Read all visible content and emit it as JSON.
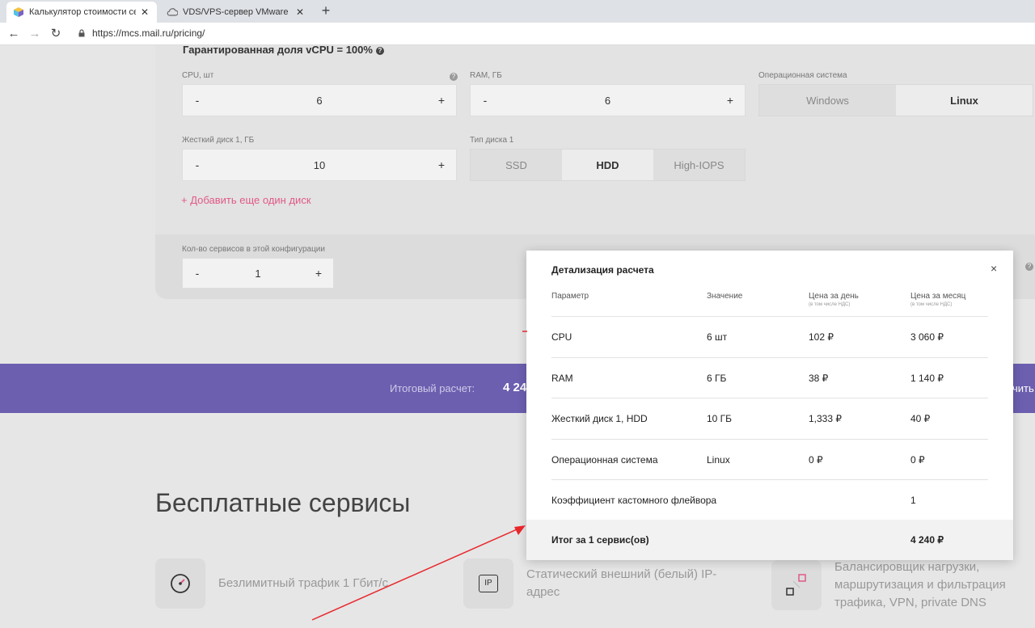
{
  "browser": {
    "tabs": [
      {
        "title": "Калькулятор стоимости серв",
        "active": true
      },
      {
        "title": "VDS/VPS-сервер VMware в",
        "active": false
      }
    ],
    "url": "https://mcs.mail.ru/pricing/"
  },
  "config": {
    "vcpu_title": "Гарантированная доля vCPU = 100%",
    "cpu": {
      "label": "CPU, шт",
      "value": "6"
    },
    "ram": {
      "label": "RAM, ГБ",
      "value": "6"
    },
    "os": {
      "label": "Операционная система",
      "options": [
        "Windows",
        "Linux"
      ],
      "selected": "Linux"
    },
    "disk": {
      "label": "Жесткий диск 1, ГБ",
      "value": "10"
    },
    "disk_type": {
      "label": "Тип диска 1",
      "options": [
        "SSD",
        "HDD",
        "High-IOPS"
      ],
      "selected": "HDD"
    },
    "add_disk": "+ Добавить еще один диск",
    "services_count": {
      "label": "Кол-во сервисов в этой конфигурации",
      "value": "1"
    },
    "minus": "-",
    "plus": "+",
    "q": "?"
  },
  "total_bar": {
    "label": "Итоговый расчет:",
    "value": "4 24",
    "order_fragment": "чить"
  },
  "free_services": {
    "title": "Бесплатные сервисы",
    "items": [
      {
        "text": "Безлимитный трафик 1 Гбит/с",
        "icon": "speedometer-icon"
      },
      {
        "text": "Статический внешний (белый) IP-адрес",
        "icon": "ip-icon",
        "icon_text": "IP"
      },
      {
        "text": "Балансировщик нагрузки, маршрутизация и фильтрация трафика, VPN, private DNS",
        "icon": "balancer-icon"
      }
    ]
  },
  "modal": {
    "title": "Детализация расчета",
    "close": "×",
    "headers": {
      "param": "Параметр",
      "value": "Значение",
      "day": "Цена за день",
      "day_sub": "(в том числе НДС)",
      "month": "Цена за месяц",
      "month_sub": "(в том числе НДС)"
    },
    "rows": [
      {
        "param": "CPU",
        "value": "6 шт",
        "day": "102 ₽",
        "month": "3 060 ₽"
      },
      {
        "param": "RAM",
        "value": "6 ГБ",
        "day": "38 ₽",
        "month": "1 140 ₽"
      },
      {
        "param": "Жесткий диск 1, HDD",
        "value": "10 ГБ",
        "day": "1,333 ₽",
        "month": "40 ₽"
      },
      {
        "param": "Операционная система",
        "value": "Linux",
        "day": "0 ₽",
        "month": "0 ₽"
      },
      {
        "param": "Коэффициент кастомного флейвора",
        "value": "",
        "day": "",
        "month": "1"
      }
    ],
    "total": {
      "label": "Итог за 1 сервис(ов)",
      "value": "4 240 ₽"
    }
  },
  "colors": {
    "accent": "#6c5fb0",
    "link": "#e05a86",
    "annotation": "#e8262b"
  }
}
